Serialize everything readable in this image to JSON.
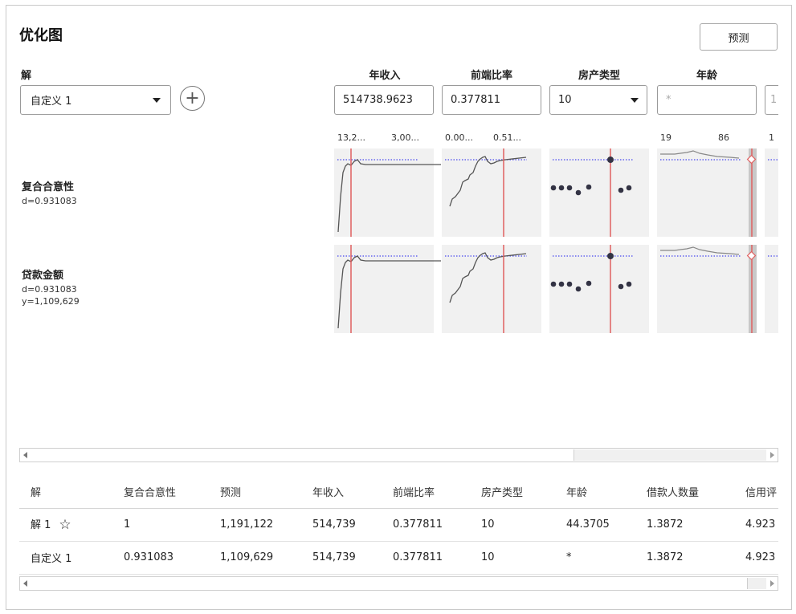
{
  "title": "优化图",
  "predict_label": "预测",
  "solution_label": "解",
  "solution_select": "自定义 1",
  "add_icon": "plus-circle-icon",
  "factors": [
    {
      "name": "年收入",
      "value": "514738.9623",
      "tick_lo": "13,2...",
      "tick_hi": "3,00..."
    },
    {
      "name": "前端比率",
      "value": "0.377811",
      "tick_lo": "0.00...",
      "tick_hi": "0.51..."
    },
    {
      "name": "房产类型",
      "value": "10",
      "tick_lo": "",
      "tick_hi": ""
    },
    {
      "name": "年龄",
      "value": "*",
      "tick_lo": "19",
      "tick_hi": "86"
    },
    {
      "name": "",
      "value": "1",
      "tick_lo": "1",
      "tick_hi": ""
    }
  ],
  "responses": [
    {
      "name": "复合合意性",
      "d": "d=0.931083",
      "y": ""
    },
    {
      "name": "贷款金额",
      "d": "d=0.931083",
      "y": "y=1,109,629"
    }
  ],
  "table": {
    "headers": [
      "解",
      "复合合意性",
      "预测",
      "年收入",
      "前端比率",
      "房产类型",
      "年龄",
      "借款人数量",
      "信用评"
    ],
    "rows": [
      [
        "解 1",
        "1",
        "1,191,122",
        "514,739",
        "0.377811",
        "10",
        "44.3705",
        "1.3872",
        "4.923"
      ],
      [
        "自定义 1",
        "0.931083",
        "1,109,629",
        "514,739",
        "0.377811",
        "10",
        "*",
        "1.3872",
        "4.923"
      ]
    ]
  },
  "colors": {
    "red_line": "#e06060",
    "dotted": "#4a4af0",
    "plot_bg": "#f1f1f1",
    "curve": "#555555",
    "dot": "#333344"
  }
}
